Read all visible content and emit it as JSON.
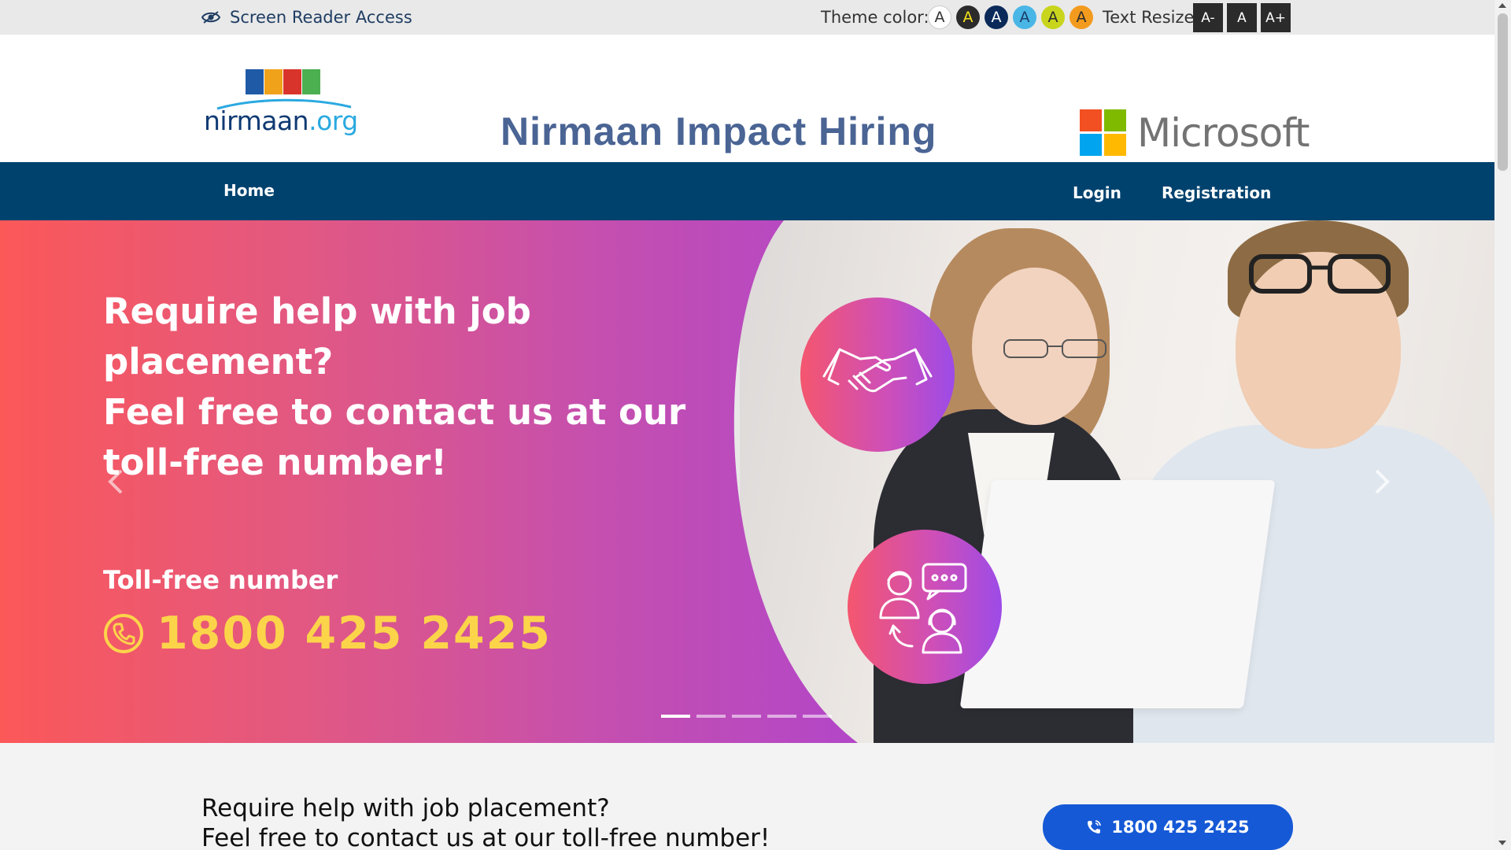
{
  "topbar": {
    "screen_reader_label": "Screen Reader Access",
    "theme_label": "Theme color:",
    "theme_swatches": [
      {
        "letter": "A",
        "bg": "#ffffff",
        "fg": "#333333"
      },
      {
        "letter": "A",
        "bg": "#2b2b2b",
        "fg": "#f5e11a"
      },
      {
        "letter": "A",
        "bg": "#0b2a5a",
        "fg": "#ffffff"
      },
      {
        "letter": "A",
        "bg": "#49b6e6",
        "fg": "#1a3c66"
      },
      {
        "letter": "A",
        "bg": "#c8d51c",
        "fg": "#2b2b2b"
      },
      {
        "letter": "A",
        "bg": "#f39b1e",
        "fg": "#2b2b2b"
      }
    ],
    "resize_label": "Text Resize:",
    "resize_buttons": [
      "A-",
      "A",
      "A+"
    ]
  },
  "header": {
    "logo_text": "nirmaan",
    "logo_suffix": ".org",
    "title": "Nirmaan Impact Hiring",
    "partner_name": "Microsoft"
  },
  "nav": {
    "home": "Home",
    "login": "Login",
    "registration": "Registration"
  },
  "hero": {
    "heading_line1": "Require help with job",
    "heading_line2": "placement?",
    "heading_line3": "Feel free to contact us at our",
    "heading_line4": "toll-free number!",
    "tollfree_label": "Toll-free number",
    "tollfree_number": "1800 425 2425",
    "slide_count": 5,
    "active_slide": 0
  },
  "bottom": {
    "line1": "Require help with job placement?",
    "line2": "Feel free to contact us at our toll-free number!",
    "call_button": "1800 425 2425"
  },
  "colors": {
    "nav_bg": "#00426e",
    "title_color": "#4a6494",
    "number_yellow": "#fcd44a",
    "call_button_bg": "#1559d6"
  }
}
